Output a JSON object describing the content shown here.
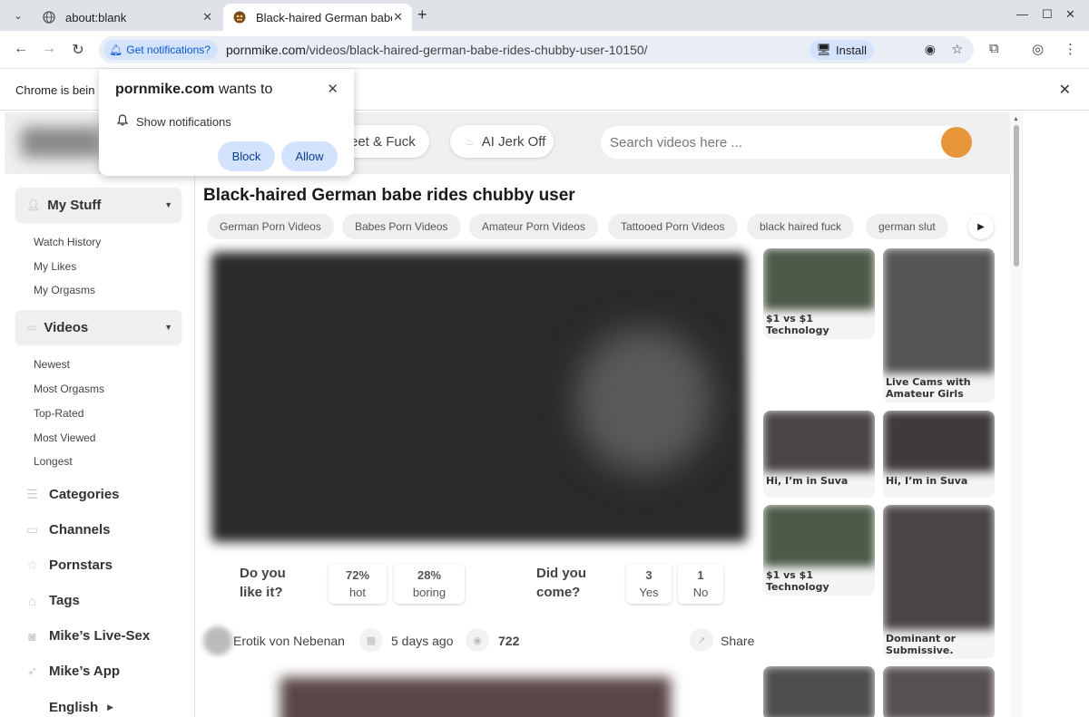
{
  "browser": {
    "tabs": [
      {
        "title": "about:blank",
        "icon": "globe-icon",
        "active": false
      },
      {
        "title": "Black-haired German babe rides chubby user",
        "icon": "site-favicon",
        "active": true
      }
    ],
    "notif_chip": "Get notifications?",
    "url_domain": "pornmike.com",
    "url_path": "/videos/black-haired-german-babe-rides-chubby-user-10150/",
    "install_label": "Install",
    "infobar_text": "Chrome is bein"
  },
  "prompt": {
    "site": "pornmike.com",
    "wants_to": "wants to",
    "permission": "Show notifications",
    "block_label": "Block",
    "allow_label": "Allow"
  },
  "header": {
    "pill1": "eet & Fuck",
    "pill2": "AI Jerk Off",
    "search_placeholder": "Search videos here ...",
    "accent": "#e8963a"
  },
  "sidebar": {
    "my_stuff": "My Stuff",
    "my_stuff_items": [
      "Watch History",
      "My Likes",
      "My Orgasms"
    ],
    "videos": "Videos",
    "videos_items": [
      "Newest",
      "Most Orgasms",
      "Top-Rated",
      "Most Viewed",
      "Longest"
    ],
    "nav": [
      {
        "label": "Categories",
        "icon": "list-icon"
      },
      {
        "label": "Channels",
        "icon": "monitor-icon"
      },
      {
        "label": "Pornstars",
        "icon": "star-icon"
      },
      {
        "label": "Tags",
        "icon": "tag-icon"
      },
      {
        "label": "Mike’s Live-Sex",
        "icon": "webcam-icon"
      },
      {
        "label": "Mike’s App",
        "icon": "rocket-icon"
      },
      {
        "label": "English",
        "icon": "flag-icon"
      }
    ]
  },
  "video": {
    "title": "Black-haired German babe rides chubby user",
    "tags": [
      "German Porn Videos",
      "Babes Porn Videos",
      "Amateur Porn Videos",
      "Tattooed Porn Videos",
      "black haired fuck",
      "german slut"
    ],
    "like_question_1": "Do you",
    "like_question_2": "like it?",
    "hot_pct": "72%",
    "hot_label": "hot",
    "boring_pct": "28%",
    "boring_label": "boring",
    "come_question_1": "Did you",
    "come_question_2": "come?",
    "yes_count": "3",
    "yes_label": "Yes",
    "no_count": "1",
    "no_label": "No",
    "uploader": "Erotik von Nebenan",
    "age": "5 days ago",
    "views": "722",
    "share_label": "Share"
  },
  "ads": [
    "$1 vs $1 Technology",
    "Live Cams with Amateur Girls",
    "Hi, I’m in Suva",
    "Hi, I’m in Suva",
    "$1 vs $1 Technology",
    "Dominant or Submissive."
  ]
}
